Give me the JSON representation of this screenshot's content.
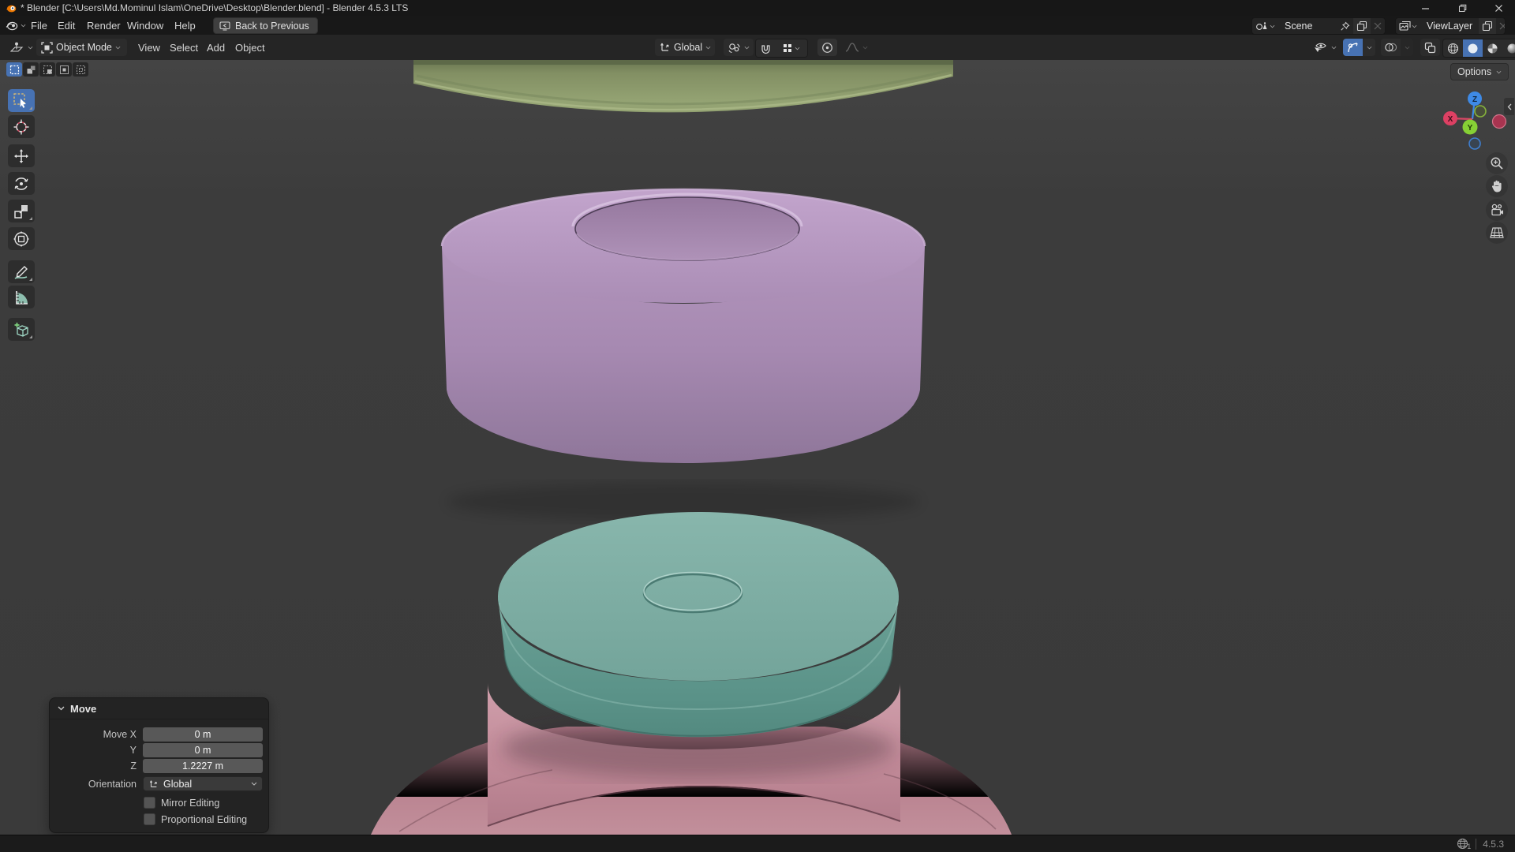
{
  "window": {
    "title": "* Blender [C:\\Users\\Md.Mominul Islam\\OneDrive\\Desktop\\Blender.blend] - Blender 4.5.3 LTS"
  },
  "topbar": {
    "menus": {
      "file": "File",
      "edit": "Edit",
      "render": "Render",
      "window": "Window",
      "help": "Help"
    },
    "back_button": "Back to Previous",
    "scene": {
      "value": "Scene"
    },
    "viewlayer": {
      "value": "ViewLayer"
    }
  },
  "viewport_header": {
    "mode": "Object Mode",
    "menus": {
      "view": "View",
      "select": "Select",
      "add": "Add",
      "object": "Object"
    },
    "orientation": "Global"
  },
  "tool_settings": {
    "options": "Options"
  },
  "nav_gizmo": {
    "x": "X",
    "y": "Y",
    "z": "Z"
  },
  "move_panel": {
    "title": "Move",
    "rows": [
      {
        "label": "Move X",
        "value": "0 m"
      },
      {
        "label": "Y",
        "value": "0 m"
      },
      {
        "label": "Z",
        "value": "1.2227 m"
      }
    ],
    "orientation_label": "Orientation",
    "orientation_value": "Global",
    "mirror_label": "Mirror Editing",
    "mirror_checked": false,
    "proportional_label": "Proportional Editing",
    "proportional_checked": false
  },
  "status_bar": {
    "version": "4.5.3",
    "extensions_count": "1"
  },
  "scene_objects": [
    {
      "name": "green cylinder (top, clipped)",
      "color": "#8f9f6e"
    },
    {
      "name": "purple cylinder with recessed top",
      "color": "#a98db4"
    },
    {
      "name": "teal lid with ring",
      "color": "#74a79c"
    },
    {
      "name": "pink jar body",
      "color": "#c08d9a"
    }
  ],
  "colors": {
    "accent": "#4772b3",
    "axis_x": "#e0415f",
    "axis_y": "#86d035",
    "axis_z": "#3e8ae6"
  }
}
